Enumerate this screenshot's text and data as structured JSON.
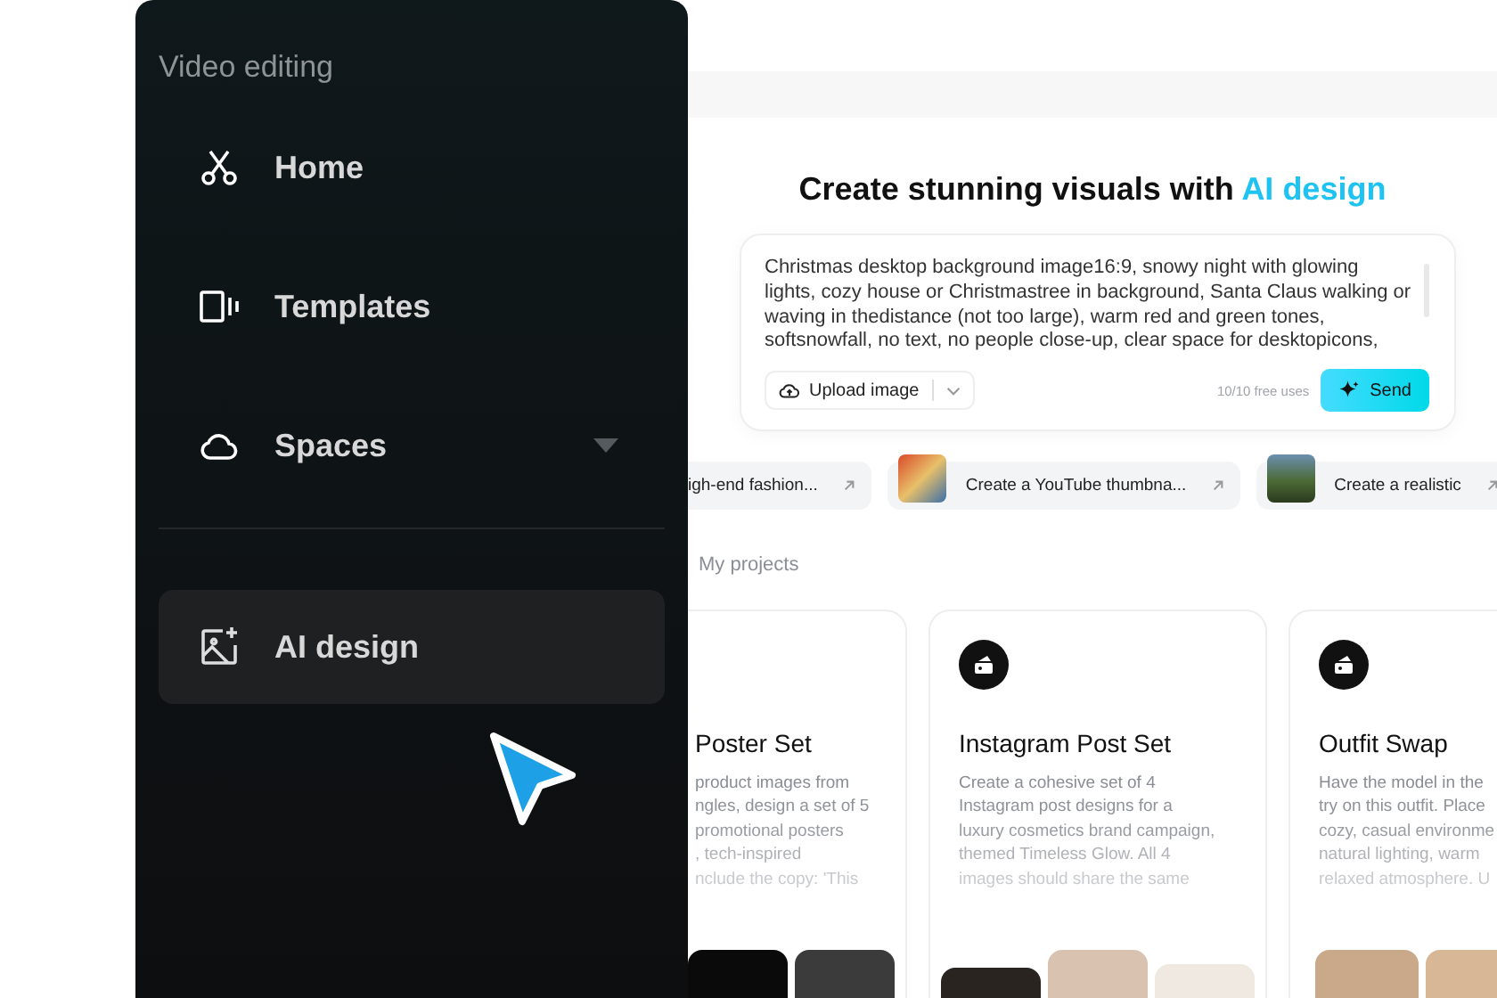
{
  "sidebar": {
    "section_title": "Video editing",
    "items": [
      {
        "label": "Home",
        "selected": false,
        "dropdown": false
      },
      {
        "label": "Templates",
        "selected": false,
        "dropdown": false
      },
      {
        "label": "Spaces",
        "selected": false,
        "dropdown": true
      }
    ],
    "bottom_items": [
      {
        "label": "AI design",
        "selected": true,
        "dropdown": false
      }
    ]
  },
  "heading": {
    "text": "Create stunning visuals with ",
    "highlight": "AI design"
  },
  "prompt": {
    "value": "Christmas desktop background image16:9, snowy night with glowing lights, cozy house or Christmastree in background, Santa Claus walking or waving in thedistance (not too large), warm red and green tones, softsnowfall, no text, no people close-up, clear space for desktopicons,",
    "upload_label": "Upload image",
    "usage": "10/10 free uses",
    "send_label": "Send"
  },
  "suggestions": [
    {
      "label": "igh-end fashion...",
      "thumbnail": false
    },
    {
      "label": "Create a YouTube thumbna...",
      "thumbnail": true
    },
    {
      "label": "Create a realistic",
      "thumbnail": true
    }
  ],
  "projects_label": "My projects",
  "cards": [
    {
      "title": "Poster Set",
      "icon": false,
      "lines": [
        "product images from",
        "ngles, design a set of 5",
        "promotional posters",
        ", tech-inspired",
        "nclude the copy: 'This"
      ]
    },
    {
      "title": "Instagram Post Set",
      "icon": true,
      "lines": [
        "Create a cohesive set of 4",
        "Instagram post designs for a",
        "luxury cosmetics brand campaign,",
        "themed Timeless Glow. All 4",
        "images should share the same"
      ]
    },
    {
      "title": "Outfit Swap",
      "icon": true,
      "lines": [
        "Have the model in the",
        "try on this outfit. Place",
        "cozy, casual environme",
        "natural lighting, warm",
        "relaxed atmosphere. U"
      ]
    }
  ]
}
